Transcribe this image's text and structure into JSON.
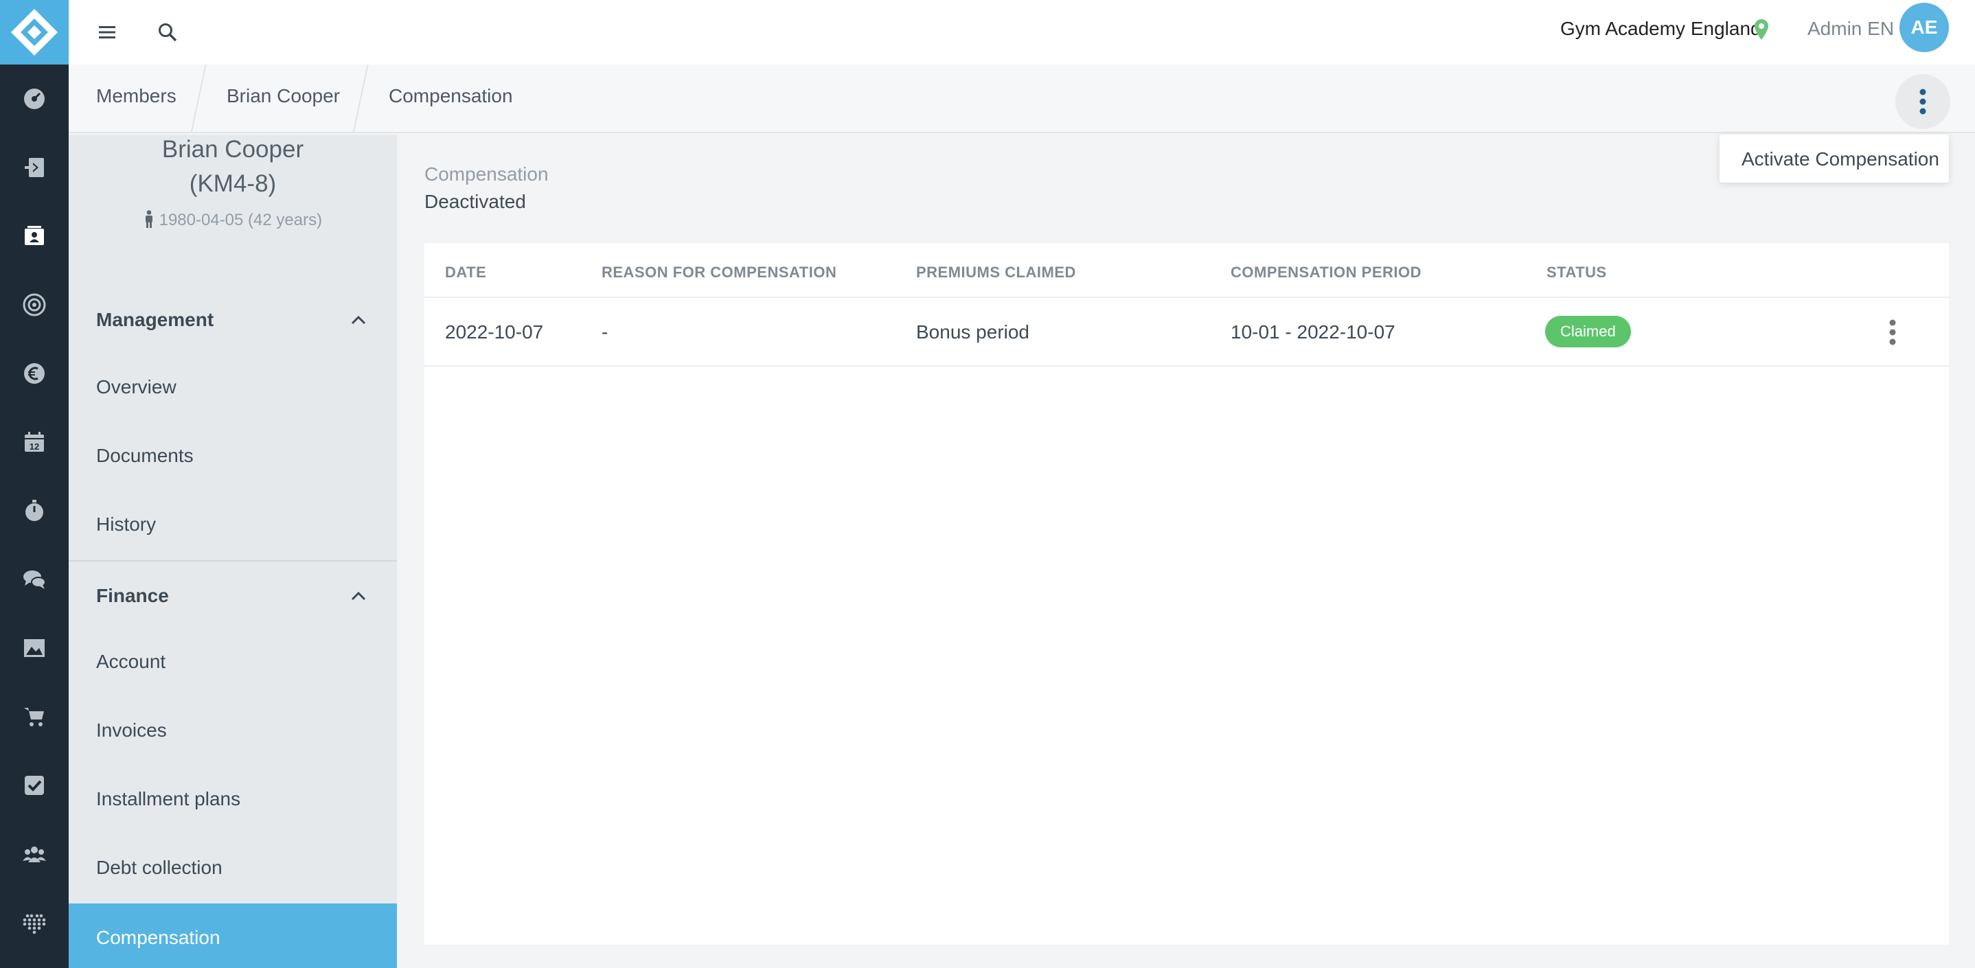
{
  "app": {
    "location_name": "Gym Academy England",
    "user_name": "Admin EN",
    "user_initials": "AE"
  },
  "rail": {
    "icons": [
      "dashboard-icon",
      "checkin-icon",
      "members-icon",
      "target-icon",
      "euro-icon",
      "calendar-icon",
      "stopwatch-icon",
      "chat-icon",
      "image-icon",
      "cart-icon",
      "checkbox-icon",
      "groups-icon",
      "apps-icon"
    ],
    "calendar_day": "12"
  },
  "breadcrumb": [
    "Members",
    "Brian Cooper",
    "Compensation"
  ],
  "actions_menu": {
    "items": [
      "Activate Compensation"
    ]
  },
  "profile": {
    "name": "Brian Cooper",
    "member_id": "(KM4-8)",
    "dob": "1980-04-05 (42 years)"
  },
  "sidebar": {
    "management": {
      "title": "Management",
      "items": [
        "Overview",
        "Documents",
        "History"
      ]
    },
    "finance": {
      "title": "Finance",
      "items": [
        "Account",
        "Invoices",
        "Installment plans",
        "Debt collection",
        "Compensation"
      ]
    },
    "active_item": "Compensation"
  },
  "compensation": {
    "label": "Compensation",
    "state": "Deactivated"
  },
  "table": {
    "headers": [
      "DATE",
      "REASON FOR COMPENSATION",
      "PREMIUMS CLAIMED",
      "COMPENSATION PERIOD",
      "STATUS"
    ],
    "rows": [
      {
        "date": "2022-10-07",
        "reason": "-",
        "premiums": "Bonus period",
        "period": "10-01 - 2022-10-07",
        "status": "Claimed"
      }
    ]
  },
  "colors": {
    "accent": "#55b4e2",
    "rail_bg": "#1e2a35",
    "status_claimed": "#5cc56a",
    "location_pin": "#6cc47a"
  }
}
